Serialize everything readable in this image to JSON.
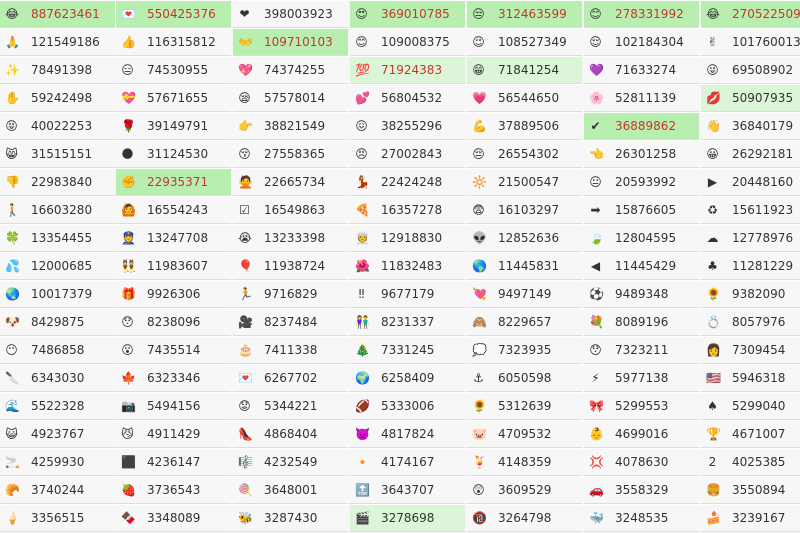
{
  "columns": [
    [
      {
        "icon": "joy-face-icon",
        "glyph": "😂",
        "count": "887623461",
        "highlight": "strong",
        "red": true
      },
      {
        "icon": "folded-hands-icon",
        "glyph": "🙏",
        "count": "121549186"
      },
      {
        "icon": "sparkles-icon",
        "glyph": "✨",
        "count": "78491398"
      },
      {
        "icon": "raised-hand-icon",
        "glyph": "✋",
        "count": "59242498"
      },
      {
        "icon": "tongue-face-icon",
        "glyph": "😝",
        "count": "40022253"
      },
      {
        "icon": "cat-face-icon",
        "glyph": "😸",
        "count": "31515151"
      },
      {
        "icon": "thumbs-down-icon",
        "glyph": "👎",
        "count": "22983840"
      },
      {
        "icon": "walking-person-icon",
        "glyph": "🚶",
        "count": "16603280"
      },
      {
        "icon": "four-leaf-clover-icon",
        "glyph": "🍀",
        "count": "13354455"
      },
      {
        "icon": "sweat-droplets-icon",
        "glyph": "💦",
        "count": "12000685"
      },
      {
        "icon": "globe-icon",
        "glyph": "🌏",
        "count": "10017379"
      },
      {
        "icon": "dog-face-icon",
        "glyph": "🐶",
        "count": "8429875"
      },
      {
        "icon": "no-mouth-face-icon",
        "glyph": "😶",
        "count": "7486858"
      },
      {
        "icon": "knife-icon",
        "glyph": "🔪",
        "count": "6343030"
      },
      {
        "icon": "wave-icon",
        "glyph": "🌊",
        "count": "5522328"
      },
      {
        "icon": "cat-face-icon",
        "glyph": "😺",
        "count": "4923767"
      },
      {
        "icon": "cigarette-icon",
        "glyph": "🚬",
        "count": "4259930"
      },
      {
        "icon": "croissant-icon",
        "glyph": "🥐",
        "count": "3740244"
      },
      {
        "icon": "ice-cream-icon",
        "glyph": "🍦",
        "count": "3356515"
      }
    ],
    [
      {
        "icon": "love-letter-icon",
        "glyph": "💌",
        "count": "550425376",
        "highlight": "strong",
        "red": true
      },
      {
        "icon": "thumbs-up-icon",
        "glyph": "👍",
        "count": "116315812"
      },
      {
        "icon": "neutral-face-icon",
        "glyph": "😑",
        "count": "74530955"
      },
      {
        "icon": "heart-ribbon-icon",
        "glyph": "💝",
        "count": "57671655"
      },
      {
        "icon": "rose-icon",
        "glyph": "🌹",
        "count": "39149791"
      },
      {
        "icon": "new-moon-icon",
        "glyph": "🌑",
        "count": "31124530"
      },
      {
        "icon": "raised-fist-icon",
        "glyph": "✊",
        "count": "22935371",
        "highlight": "strong",
        "red": true
      },
      {
        "icon": "person-gesturing-icon",
        "glyph": "🙆",
        "count": "16554243"
      },
      {
        "icon": "police-officer-icon",
        "glyph": "👮",
        "count": "13247708"
      },
      {
        "icon": "two-women-icon",
        "glyph": "👯",
        "count": "11983607"
      },
      {
        "icon": "gift-icon",
        "glyph": "🎁",
        "count": "9926306"
      },
      {
        "icon": "astonished-face-icon",
        "glyph": "😯",
        "count": "8238096"
      },
      {
        "icon": "surprised-face-icon",
        "glyph": "😮",
        "count": "7435514"
      },
      {
        "icon": "maple-leaf-icon",
        "glyph": "🍁",
        "count": "6323346"
      },
      {
        "icon": "camera-icon",
        "glyph": "📷",
        "count": "5494156"
      },
      {
        "icon": "grinning-cat-icon",
        "glyph": "😼",
        "count": "4911429"
      },
      {
        "icon": "black-square-icon",
        "glyph": "⬛",
        "count": "4236147"
      },
      {
        "icon": "strawberry-icon",
        "glyph": "🍓",
        "count": "3736543"
      },
      {
        "icon": "chocolate-bar-icon",
        "glyph": "🍫",
        "count": "3348089"
      }
    ],
    [
      {
        "icon": "red-heart-icon",
        "glyph": "❤",
        "count": "398003923"
      },
      {
        "icon": "open-hands-icon",
        "glyph": "👐",
        "count": "109710103",
        "highlight": "strong",
        "red": true
      },
      {
        "icon": "sparkling-heart-icon",
        "glyph": "💖",
        "count": "74374255"
      },
      {
        "icon": "relieved-face-icon",
        "glyph": "😪",
        "count": "57578014"
      },
      {
        "icon": "pointing-hand-icon",
        "glyph": "👉",
        "count": "38821549"
      },
      {
        "icon": "kissing-face-icon",
        "glyph": "😚",
        "count": "27558365"
      },
      {
        "icon": "person-gesturing-icon",
        "glyph": "🙅",
        "count": "22665734"
      },
      {
        "icon": "check-box-icon",
        "glyph": "☑",
        "count": "16549863"
      },
      {
        "icon": "crying-face-icon",
        "glyph": "😭",
        "count": "13233398"
      },
      {
        "icon": "balloon-icon",
        "glyph": "🎈",
        "count": "11938724"
      },
      {
        "icon": "running-person-icon",
        "glyph": "🏃",
        "count": "9716829"
      },
      {
        "icon": "movie-camera-icon",
        "glyph": "🎥",
        "count": "8237484"
      },
      {
        "icon": "birthday-cake-icon",
        "glyph": "🎂",
        "count": "7411338"
      },
      {
        "icon": "envelope-heart-icon",
        "glyph": "💌",
        "count": "6267702"
      },
      {
        "icon": "worried-face-icon",
        "glyph": "😟",
        "count": "5344221"
      },
      {
        "icon": "high-heel-icon",
        "glyph": "👠",
        "count": "4868404"
      },
      {
        "icon": "musical-score-icon",
        "glyph": "🎼",
        "count": "4232549"
      },
      {
        "icon": "lollipop-icon",
        "glyph": "🍭",
        "count": "3648001"
      },
      {
        "icon": "bee-icon",
        "glyph": "🐝",
        "count": "3287430"
      }
    ],
    [
      {
        "icon": "heart-eyes-face-icon",
        "glyph": "😍",
        "count": "369010785",
        "highlight": "strong",
        "red": true
      },
      {
        "icon": "smiling-face-icon",
        "glyph": "😊",
        "count": "109008375"
      },
      {
        "icon": "hundred-points-icon",
        "glyph": "💯",
        "count": "71924383",
        "highlight": "light",
        "red": true
      },
      {
        "icon": "two-hearts-icon",
        "glyph": "💕",
        "count": "56804532"
      },
      {
        "icon": "persevering-face-icon",
        "glyph": "😖",
        "count": "38255296"
      },
      {
        "icon": "confounded-face-icon",
        "glyph": "😣",
        "count": "27002843"
      },
      {
        "icon": "dancer-icon",
        "glyph": "💃",
        "count": "22424248"
      },
      {
        "icon": "pizza-icon",
        "glyph": "🍕",
        "count": "16357278"
      },
      {
        "icon": "person-with-turban-icon",
        "glyph": "👳",
        "count": "12918830"
      },
      {
        "icon": "hibiscus-icon",
        "glyph": "🌺",
        "count": "11832483"
      },
      {
        "icon": "double-exclamation-icon",
        "glyph": "‼",
        "count": "9677179"
      },
      {
        "icon": "couple-icon",
        "glyph": "👫",
        "count": "8231337"
      },
      {
        "icon": "christmas-tree-icon",
        "glyph": "🎄",
        "count": "7331245"
      },
      {
        "icon": "globe-icon",
        "glyph": "🌍",
        "count": "6258409"
      },
      {
        "icon": "football-icon",
        "glyph": "🏈",
        "count": "5333006"
      },
      {
        "icon": "purple-devil-icon",
        "glyph": "👿",
        "count": "4817824"
      },
      {
        "icon": "orange-diamond-icon",
        "glyph": "🔸",
        "count": "4174167"
      },
      {
        "icon": "top-arrow-icon",
        "glyph": "🔝",
        "count": "3643707"
      },
      {
        "icon": "clapper-board-icon",
        "glyph": "🎬",
        "count": "3278698",
        "highlight": "light"
      }
    ],
    [
      {
        "icon": "unamused-face-icon",
        "glyph": "😒",
        "count": "312463599",
        "highlight": "strong",
        "red": true
      },
      {
        "icon": "winking-face-icon",
        "glyph": "😉",
        "count": "108527349"
      },
      {
        "icon": "grinning-face-icon",
        "glyph": "😁",
        "count": "71841254",
        "highlight": "light"
      },
      {
        "icon": "pink-heart-icon",
        "glyph": "💗",
        "count": "56544650"
      },
      {
        "icon": "flexed-biceps-icon",
        "glyph": "💪",
        "count": "37889506"
      },
      {
        "icon": "pensive-face-icon",
        "glyph": "😔",
        "count": "26554302"
      },
      {
        "icon": "sun-icon",
        "glyph": "🔆",
        "count": "21500547"
      },
      {
        "icon": "fearful-face-icon",
        "glyph": "😨",
        "count": "16103297"
      },
      {
        "icon": "alien-icon",
        "glyph": "👽",
        "count": "12852636"
      },
      {
        "icon": "earth-globe-icon",
        "glyph": "🌎",
        "count": "11445831"
      },
      {
        "icon": "heart-with-arrow-icon",
        "glyph": "💘",
        "count": "9497149"
      },
      {
        "icon": "monkey-face-icon",
        "glyph": "🙈",
        "count": "8229657"
      },
      {
        "icon": "speech-bubble-icon",
        "glyph": "💭",
        "count": "7323935"
      },
      {
        "icon": "anchor-icon",
        "glyph": "⚓",
        "count": "6050598"
      },
      {
        "icon": "sunflower-icon",
        "glyph": "🌻",
        "count": "5312639"
      },
      {
        "icon": "pig-face-icon",
        "glyph": "🐷",
        "count": "4709532"
      },
      {
        "icon": "tropical-drink-icon",
        "glyph": "🍹",
        "count": "4148359"
      },
      {
        "icon": "hushed-face-icon",
        "glyph": "😲",
        "count": "3609529"
      },
      {
        "icon": "no-under-eighteen-icon",
        "glyph": "🔞",
        "count": "3264798"
      }
    ],
    [
      {
        "icon": "smiling-face-icon",
        "glyph": "😊",
        "count": "278331992",
        "highlight": "strong",
        "red": true
      },
      {
        "icon": "relieved-face-icon",
        "glyph": "😌",
        "count": "102184304"
      },
      {
        "icon": "purple-heart-icon",
        "glyph": "💜",
        "count": "71633274"
      },
      {
        "icon": "cherry-blossom-icon",
        "glyph": "🌸",
        "count": "52811139"
      },
      {
        "icon": "check-mark-icon",
        "glyph": "✔",
        "count": "36889862",
        "highlight": "strong",
        "red": true
      },
      {
        "icon": "pointing-left-icon",
        "glyph": "👈",
        "count": "26301258"
      },
      {
        "icon": "neutral-face-icon",
        "glyph": "😐",
        "count": "20593992"
      },
      {
        "icon": "right-arrow-icon",
        "glyph": "➡",
        "count": "15876605"
      },
      {
        "icon": "leaf-icon",
        "glyph": "🍃",
        "count": "12804595"
      },
      {
        "icon": "left-arrow-icon",
        "glyph": "◀",
        "count": "11445429"
      },
      {
        "icon": "soccer-ball-icon",
        "glyph": "⚽",
        "count": "9489348"
      },
      {
        "icon": "bouquet-icon",
        "glyph": "💐",
        "count": "8089196"
      },
      {
        "icon": "astonished-face-icon",
        "glyph": "😯",
        "count": "7323211"
      },
      {
        "icon": "high-voltage-icon",
        "glyph": "⚡",
        "count": "5977138"
      },
      {
        "icon": "pink-flowers-icon",
        "glyph": "🎀",
        "count": "5299553"
      },
      {
        "icon": "baby-face-icon",
        "glyph": "👶",
        "count": "4699016"
      },
      {
        "icon": "anger-symbol-icon",
        "glyph": "💢",
        "count": "4078630"
      },
      {
        "icon": "red-car-icon",
        "glyph": "🚗",
        "count": "3558329"
      },
      {
        "icon": "whale-icon",
        "glyph": "🐳",
        "count": "3248535"
      }
    ],
    [
      {
        "icon": "joy-face-icon",
        "glyph": "😂",
        "count": "270522509",
        "highlight": "strong",
        "red": true
      },
      {
        "icon": "victory-hand-icon",
        "glyph": "✌",
        "count": "101760013"
      },
      {
        "icon": "winking-tongue-face-icon",
        "glyph": "😜",
        "count": "69508902"
      },
      {
        "icon": "kiss-mark-icon",
        "glyph": "💋",
        "count": "50907935",
        "highlight": "light"
      },
      {
        "icon": "waving-hand-icon",
        "glyph": "👋",
        "count": "36840179"
      },
      {
        "icon": "grinning-face-icon",
        "glyph": "😀",
        "count": "26292181"
      },
      {
        "icon": "play-button-icon",
        "glyph": "▶",
        "count": "20448160"
      },
      {
        "icon": "recycling-icon",
        "glyph": "♻",
        "count": "15611923"
      },
      {
        "icon": "cloud-icon",
        "glyph": "☁",
        "count": "12778976"
      },
      {
        "icon": "club-suit-icon",
        "glyph": "♣",
        "count": "11281229"
      },
      {
        "icon": "sunflower-icon",
        "glyph": "🌻",
        "count": "9382090"
      },
      {
        "icon": "ring-icon",
        "glyph": "💍",
        "count": "8057976"
      },
      {
        "icon": "woman-face-icon",
        "glyph": "👩",
        "count": "7309454"
      },
      {
        "icon": "us-flag-icon",
        "glyph": "🇺🇸",
        "count": "5946318"
      },
      {
        "icon": "spade-suit-icon",
        "glyph": "♠",
        "count": "5299040"
      },
      {
        "icon": "trophy-icon",
        "glyph": "🏆",
        "count": "4671007"
      },
      {
        "icon": "keycap-two-icon",
        "glyph": "2",
        "count": "4025385"
      },
      {
        "icon": "hamburger-icon",
        "glyph": "🍔",
        "count": "3550894"
      },
      {
        "icon": "cake-slice-icon",
        "glyph": "🍰",
        "count": "3239167"
      }
    ]
  ]
}
